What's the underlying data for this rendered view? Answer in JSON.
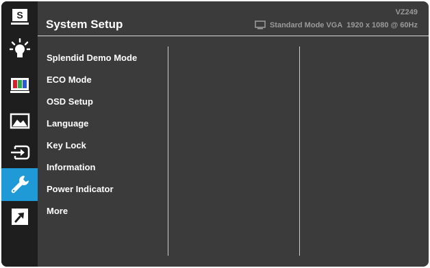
{
  "header": {
    "title": "System Setup",
    "model": "VZ249",
    "mode": "Standard Mode VGA",
    "resolution": "1920 x 1080 @ 60Hz"
  },
  "sidebar": {
    "active_index": 6,
    "active_color": "#1f9ad6",
    "items": [
      {
        "icon": "splendid-s-icon",
        "label": "S"
      },
      {
        "icon": "brightness-bulb-icon"
      },
      {
        "icon": "color-bars-icon"
      },
      {
        "icon": "image-landscape-icon"
      },
      {
        "icon": "input-select-icon"
      },
      {
        "icon": "wrench-icon"
      },
      {
        "icon": "shortcut-arrow-icon"
      }
    ]
  },
  "menu": {
    "items": [
      "Splendid Demo Mode",
      "ECO Mode",
      "OSD Setup",
      "Language",
      "Key Lock",
      "Information",
      "Power Indicator",
      "More"
    ]
  }
}
